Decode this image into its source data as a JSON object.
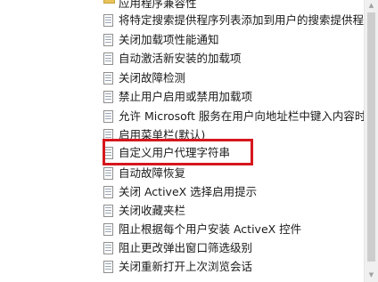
{
  "tree": {
    "items": [
      {
        "label": "应用程序兼容性",
        "icon": "folder-icon"
      },
      {
        "label": "将特定搜索提供程序列表添加到用户的搜索提供程序",
        "icon": "policy-setting-icon"
      },
      {
        "label": "关闭加载项性能通知",
        "icon": "policy-setting-icon"
      },
      {
        "label": "自动激活新安装的加载项",
        "icon": "policy-setting-icon"
      },
      {
        "label": "关闭故障检测",
        "icon": "policy-setting-icon"
      },
      {
        "label": "禁止用户启用或禁用加载项",
        "icon": "policy-setting-icon"
      },
      {
        "label": "允许 Microsoft 服务在用户向地址栏中键入内容时提",
        "icon": "policy-setting-icon"
      },
      {
        "label": "启用菜单栏(默认)",
        "icon": "policy-setting-icon"
      },
      {
        "label": "自定义用户代理字符串",
        "icon": "policy-setting-icon"
      },
      {
        "label": "自动故障恢复",
        "icon": "policy-setting-icon"
      },
      {
        "label": "关闭 ActiveX 选择启用提示",
        "icon": "policy-setting-icon"
      },
      {
        "label": "关闭收藏夹栏",
        "icon": "policy-setting-icon"
      },
      {
        "label": "阻止根据每个用户安装 ActiveX 控件",
        "icon": "policy-setting-icon"
      },
      {
        "label": "阻止更改弹出窗口筛选级别",
        "icon": "policy-setting-icon"
      },
      {
        "label": "关闭重新打开上次浏览会话",
        "icon": "policy-setting-icon"
      }
    ]
  },
  "colors": {
    "highlight_border": "#d6171d",
    "text": "#1a1a1a",
    "scrollbar_track": "#f0f0f0",
    "scrollbar_thumb": "#cdcdcd"
  }
}
